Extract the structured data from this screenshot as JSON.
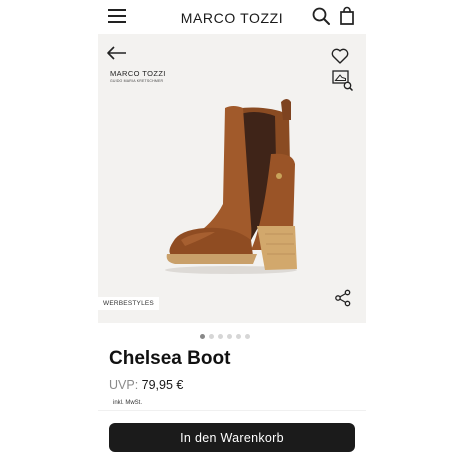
{
  "header": {
    "brand": "MARCO TOZZI",
    "menu_icon": "hamburger-menu-icon",
    "search_icon": "search-icon",
    "bag_icon": "shopping-bag-icon"
  },
  "gallery": {
    "back_icon": "arrow-left-icon",
    "wishlist_icon": "heart-icon",
    "size_icon": "shoe-size-search-icon",
    "share_icon": "share-icon",
    "logo_main": "MARCO TOZZI",
    "logo_sub": "GUIDO MARIA KRETSCHMER",
    "badge": "WERBESTYLES",
    "background_color": "#f3f2f0",
    "image_count": 6,
    "active_index": 0
  },
  "product": {
    "title": "Chelsea Boot",
    "uvp_label": "UVP:",
    "price": "79,95 €",
    "tax_note": "inkl. MwSt."
  },
  "cta": {
    "label": "In den Warenkorb",
    "color": "#1b1b1b"
  }
}
